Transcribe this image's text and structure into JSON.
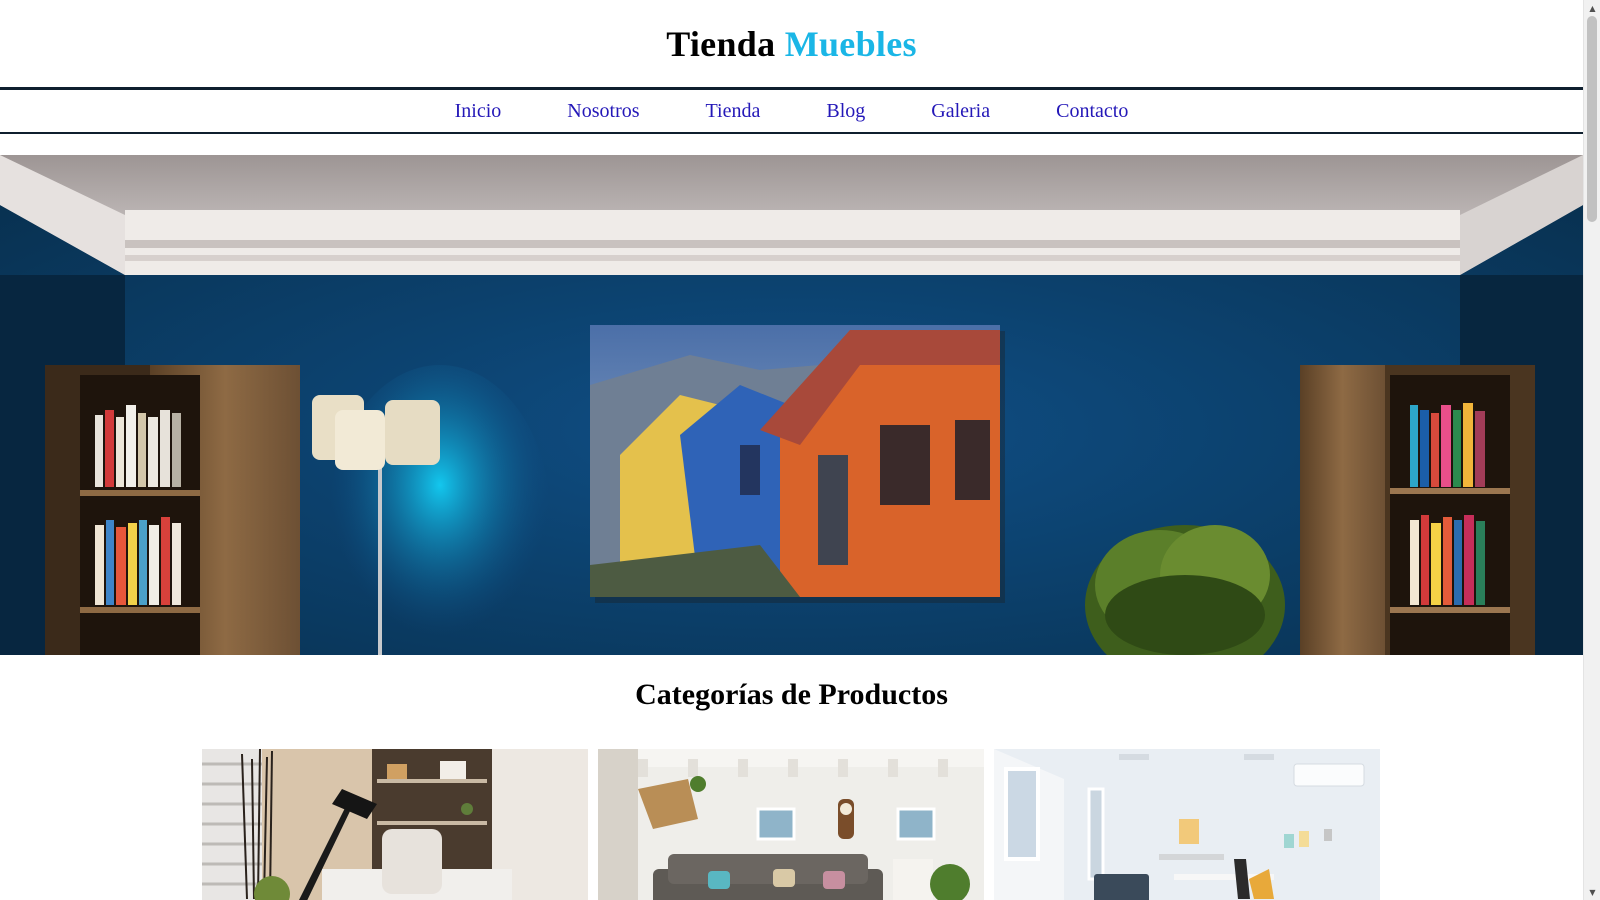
{
  "header": {
    "title_main": "Tienda",
    "title_accent": "Muebles",
    "accent_color": "#1ab6e6"
  },
  "nav": {
    "items": [
      {
        "label": "Inicio"
      },
      {
        "label": "Nosotros"
      },
      {
        "label": "Tienda"
      },
      {
        "label": "Blog"
      },
      {
        "label": "Galeria"
      },
      {
        "label": "Contacto"
      }
    ],
    "link_color": "#2418b8"
  },
  "hero": {
    "image": "living-room-blue-wall-painting"
  },
  "categories": {
    "title": "Categorías de Productos",
    "cards": [
      {
        "image": "office-desk-lamp-photo"
      },
      {
        "image": "living-room-sofa-photo"
      },
      {
        "image": "white-dining-room-photo"
      }
    ]
  },
  "scrollbar": {
    "up_icon": "arrow-up-icon",
    "down_icon": "arrow-down-icon"
  }
}
